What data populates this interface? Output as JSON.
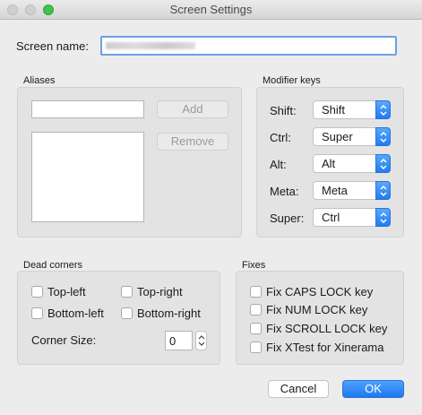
{
  "window": {
    "title": "Screen Settings"
  },
  "screen_name": {
    "label": "Screen name:",
    "value": ""
  },
  "aliases": {
    "title": "Aliases",
    "input_value": "",
    "add_label": "Add",
    "remove_label": "Remove",
    "list_items": []
  },
  "modifier_keys": {
    "title": "Modifier keys",
    "rows": [
      {
        "label": "Shift:",
        "value": "Shift"
      },
      {
        "label": "Ctrl:",
        "value": "Super"
      },
      {
        "label": "Alt:",
        "value": "Alt"
      },
      {
        "label": "Meta:",
        "value": "Meta"
      },
      {
        "label": "Super:",
        "value": "Ctrl"
      }
    ]
  },
  "dead_corners": {
    "title": "Dead corners",
    "top_left": "Top-left",
    "top_right": "Top-right",
    "bottom_left": "Bottom-left",
    "bottom_right": "Bottom-right",
    "corner_size_label": "Corner Size:",
    "corner_size_value": "0"
  },
  "fixes": {
    "title": "Fixes",
    "items": [
      "Fix CAPS LOCK key",
      "Fix NUM LOCK key",
      "Fix SCROLL LOCK key",
      "Fix XTest for Xinerama"
    ]
  },
  "buttons": {
    "cancel": "Cancel",
    "ok": "OK"
  },
  "colors": {
    "accent": "#1f7cf1",
    "zoom": "#3fc24f"
  },
  "icons": [
    "close-traffic-light",
    "minimize-traffic-light",
    "zoom-traffic-light",
    "popup-arrows-icon",
    "stepper-arrows-icon"
  ]
}
